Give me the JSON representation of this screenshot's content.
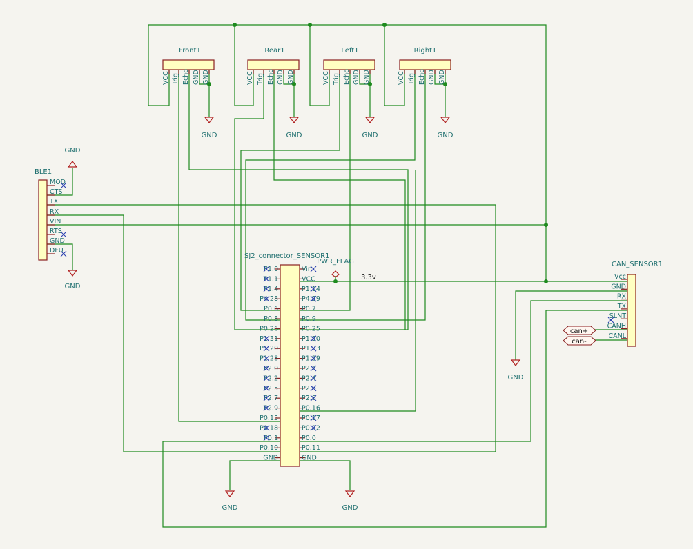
{
  "sensors": [
    {
      "ref": "Front1",
      "pins": [
        "VCC",
        "Trig",
        "Echo",
        "GND",
        "GND"
      ],
      "gnd_label": "GND"
    },
    {
      "ref": "Rear1",
      "pins": [
        "VCC",
        "Trig",
        "Echo",
        "GND",
        "GND"
      ],
      "gnd_label": "GND"
    },
    {
      "ref": "Left1",
      "pins": [
        "VCC",
        "Trig",
        "Echo",
        "GND",
        "GND"
      ],
      "gnd_label": "GND"
    },
    {
      "ref": "Right1",
      "pins": [
        "VCC",
        "Trig",
        "Echo",
        "GND",
        "GND"
      ],
      "gnd_label": "GND"
    }
  ],
  "ble": {
    "ref": "BLE1",
    "pins": [
      "MOD",
      "CTS",
      "TX",
      "RX",
      "VIN",
      "RTS",
      "GND",
      "DFU"
    ],
    "gnd_top": "GND",
    "gnd_bottom": "GND"
  },
  "sj2": {
    "ref": "SJ2_connector_SENSOR1",
    "left_pins": [
      "P1.0",
      "P1.1",
      "P1.4",
      "P4.28",
      "P0.6",
      "P0.8",
      "P0.26",
      "P1.31",
      "P1.20",
      "P1.28",
      "P2.0",
      "P2.2",
      "P2.5",
      "P2.7",
      "P2.9",
      "P0.15",
      "P0.18",
      "P0.1",
      "P0.10",
      "GND"
    ],
    "right_pins": [
      "Vin",
      "VCC",
      "P1.14",
      "P4.29",
      "P0.7",
      "P0.9",
      "P0.25",
      "P1.30",
      "P1.23",
      "P1.29",
      "P2.1",
      "P2.4",
      "P2.6",
      "P2.8",
      "P0.16",
      "P0.17",
      "P0.22",
      "P0.0",
      "P0.11",
      "GND"
    ],
    "gnd_left": "GND",
    "gnd_right": "GND"
  },
  "pwr_flag": "PWR_FLAG",
  "net_3v3": "3.3v",
  "can": {
    "ref": "CAN_SENSOR1",
    "pins": [
      "Vcc",
      "GND",
      "RX",
      "TX",
      "SLNT",
      "CANH",
      "CANL"
    ],
    "gnd_label": "GND",
    "label_canp": "can+",
    "label_canm": "can-"
  },
  "colors": {
    "background": "#f5f4ef",
    "wire": "#1e8a1e",
    "component_body": "#ffffc2",
    "component_outline": "#8a1f1f",
    "text": "#1f6f6f",
    "no_connect": "#2a3fb0",
    "ground_symbol": "#b02020"
  }
}
